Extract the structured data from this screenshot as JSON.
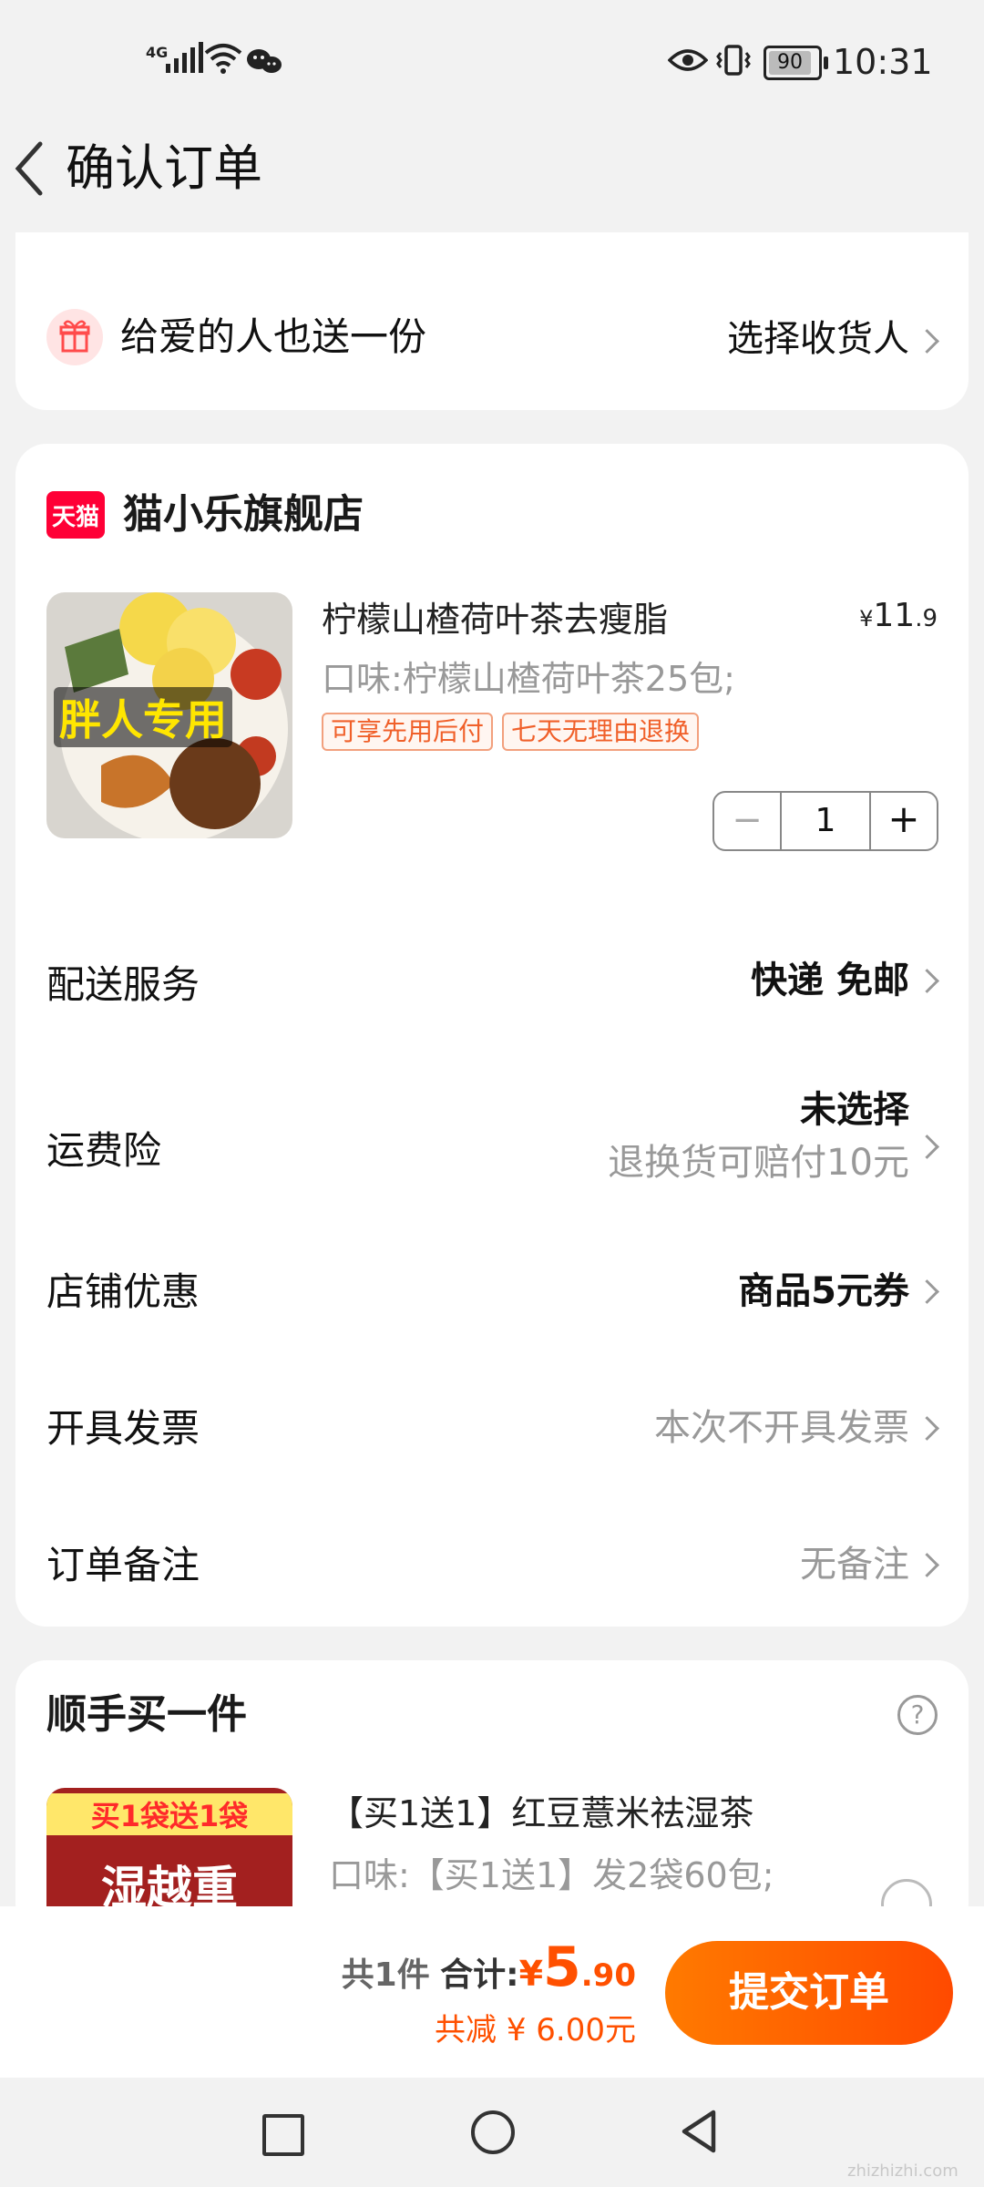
{
  "status_bar": {
    "network": "4G",
    "battery": "90",
    "time": "10:31"
  },
  "header": {
    "title": "确认订单"
  },
  "gift": {
    "label": "给爱的人也送一份",
    "action": "选择收货人"
  },
  "store": {
    "badge": "天猫",
    "name": "猫小乐旗舰店"
  },
  "product": {
    "image_text": "胖人专用",
    "title": "柠檬山楂荷叶茶去瘦脂",
    "price_symbol": "¥",
    "price_int": "11",
    "price_dec": ".9",
    "spec": "口味:柠檬山楂荷叶茶25包;",
    "tags": [
      "可享先用后付",
      "七天无理由退换"
    ],
    "quantity": "1",
    "minus": "−",
    "plus": "+"
  },
  "rows": [
    {
      "label": "配送服务",
      "value": "快递 免邮"
    },
    {
      "label": "运费险",
      "value": "未选择",
      "sub": "退换货可赔付10元"
    },
    {
      "label": "店铺优惠",
      "value": "商品5元券"
    },
    {
      "label": "开具发票",
      "value": "本次不开具发票"
    },
    {
      "label": "订单备注",
      "value": "无备注"
    }
  ],
  "upsell": {
    "title": "顺手买一件",
    "help": "?",
    "image_top": "买1袋送1袋",
    "image_mid": "湿越重",
    "item_title": "【买1送1】红豆薏米祛湿茶",
    "item_spec": "口味:【买1送1】发2袋60包;"
  },
  "checkout": {
    "count": "共1件",
    "total_label": "合计:",
    "total_symbol": "¥",
    "total_int": "5",
    "total_dec": ".90",
    "saved": "共减 ¥ 6.00元",
    "submit": "提交订单"
  },
  "colors": {
    "accent": "#ff5000",
    "button_start": "#ff7a00",
    "button_end": "#ff4a00",
    "tmall_red": "#ff0036"
  },
  "watermark": "zhizhizhi.com"
}
